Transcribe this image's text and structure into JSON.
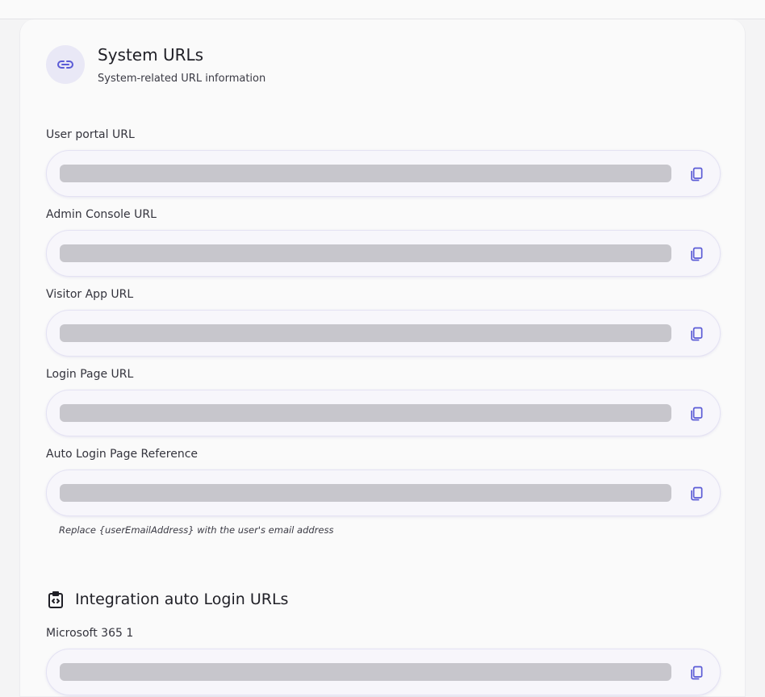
{
  "section": {
    "icon": "link-icon",
    "title": "System URLs",
    "subtitle": "System-related URL information"
  },
  "fields": [
    {
      "label": "User portal URL"
    },
    {
      "label": "Admin Console URL"
    },
    {
      "label": "Visitor App URL"
    },
    {
      "label": "Login Page URL"
    },
    {
      "label": "Auto Login Page Reference"
    }
  ],
  "auto_login_hint": "Replace {userEmailAddress} with the user's email address",
  "integration": {
    "icon": "code-clipboard-icon",
    "title": "Integration auto Login URLs",
    "fields": [
      {
        "label": "Microsoft 365 1"
      }
    ]
  },
  "colors": {
    "accent": "#5b5bd6",
    "icon_bg": "#e9e8f6",
    "redacted_bar": "#c7c6cc"
  }
}
